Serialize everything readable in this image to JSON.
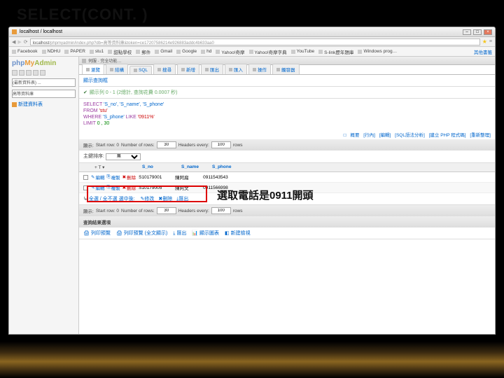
{
  "slide": {
    "title": "SELECT(CONT. )"
  },
  "browser": {
    "tab_title": "localhost / localhost",
    "url_prefix": "localhost",
    "url": "/phpmyadmin/index.php?db=高等資料庫&token=ce17207586214e926883addc4b633aa0",
    "bookmarks": [
      "Facebook",
      "NDHU",
      "PAPER",
      "stu1",
      "甜點學校",
      "郵件",
      "Gmail",
      "Google",
      "hd",
      "Yahoo!奇摩",
      "Yahoo!奇摩字典",
      "YouTube",
      "S-link歷年題庫",
      "Windows prog…",
      "其他書籤"
    ]
  },
  "sidebar": {
    "logo_parts": [
      "php",
      "My",
      "Admin"
    ],
    "select1": "(最新資料表) ...",
    "select2": "高等資料庫",
    "new_table": "新建資料表"
  },
  "server_bar": {
    "text": "伺服 · 完全功能…"
  },
  "tabs": [
    "瀏覽",
    "結構",
    "SQL",
    "搜尋",
    "新增",
    "匯出",
    "匯入",
    "操作",
    "觸發器"
  ],
  "msg_title": "顯示查詢框",
  "msg_result": "顯示列 0 - 1 (2總計, 查詢花費 0.0007 秒)",
  "sql": {
    "select": "SELECT",
    "cols": "'S_no', 'S_name', 'S_phone'",
    "from": "FROM",
    "table": "'stu'",
    "where": "WHERE",
    "cond_col": "'S_phone'",
    "like": "LIKE",
    "pattern": "'0911%'",
    "limit": "LIMIT",
    "limit_vals": "0 , 30"
  },
  "sql_actions": [
    "概要",
    "[行內]",
    "[編輯]",
    "[SQL語法分析]",
    "[建立 PHP 程式碼]",
    "[重新整理]"
  ],
  "nav_bar": {
    "show_label": "顯示:",
    "start_at": "Start row: 0",
    "rows_lbl": "Number of rows:",
    "rows_val": "30",
    "headers_lbl": "Headers every:",
    "headers_val": "100",
    "rows_suffix": "rows"
  },
  "sort_bar": {
    "label": "主鍵排序:",
    "value": "無"
  },
  "columns": [
    "S_no",
    "S_name",
    "S_phone"
  ],
  "row_actions": [
    "編輯",
    "複製",
    "刪除"
  ],
  "rows": [
    {
      "sno": "S10179001",
      "sname": "陳阿扁",
      "sphone": "0911543543"
    },
    {
      "sno": "S10179005",
      "sname": "陳阿文",
      "sphone": "0911566998"
    }
  ],
  "checkall": {
    "label": "全選 / 全不選 選中後:",
    "actions": [
      "修改",
      "刪除",
      "匯出"
    ]
  },
  "result_ops": "查詢結果選項",
  "print_ops": [
    "列印預覽",
    "列印預覽 (全文顯示)",
    "匯出",
    "顯示圖表",
    "新建檢視"
  ],
  "annotation": "選取電話是0911開頭"
}
